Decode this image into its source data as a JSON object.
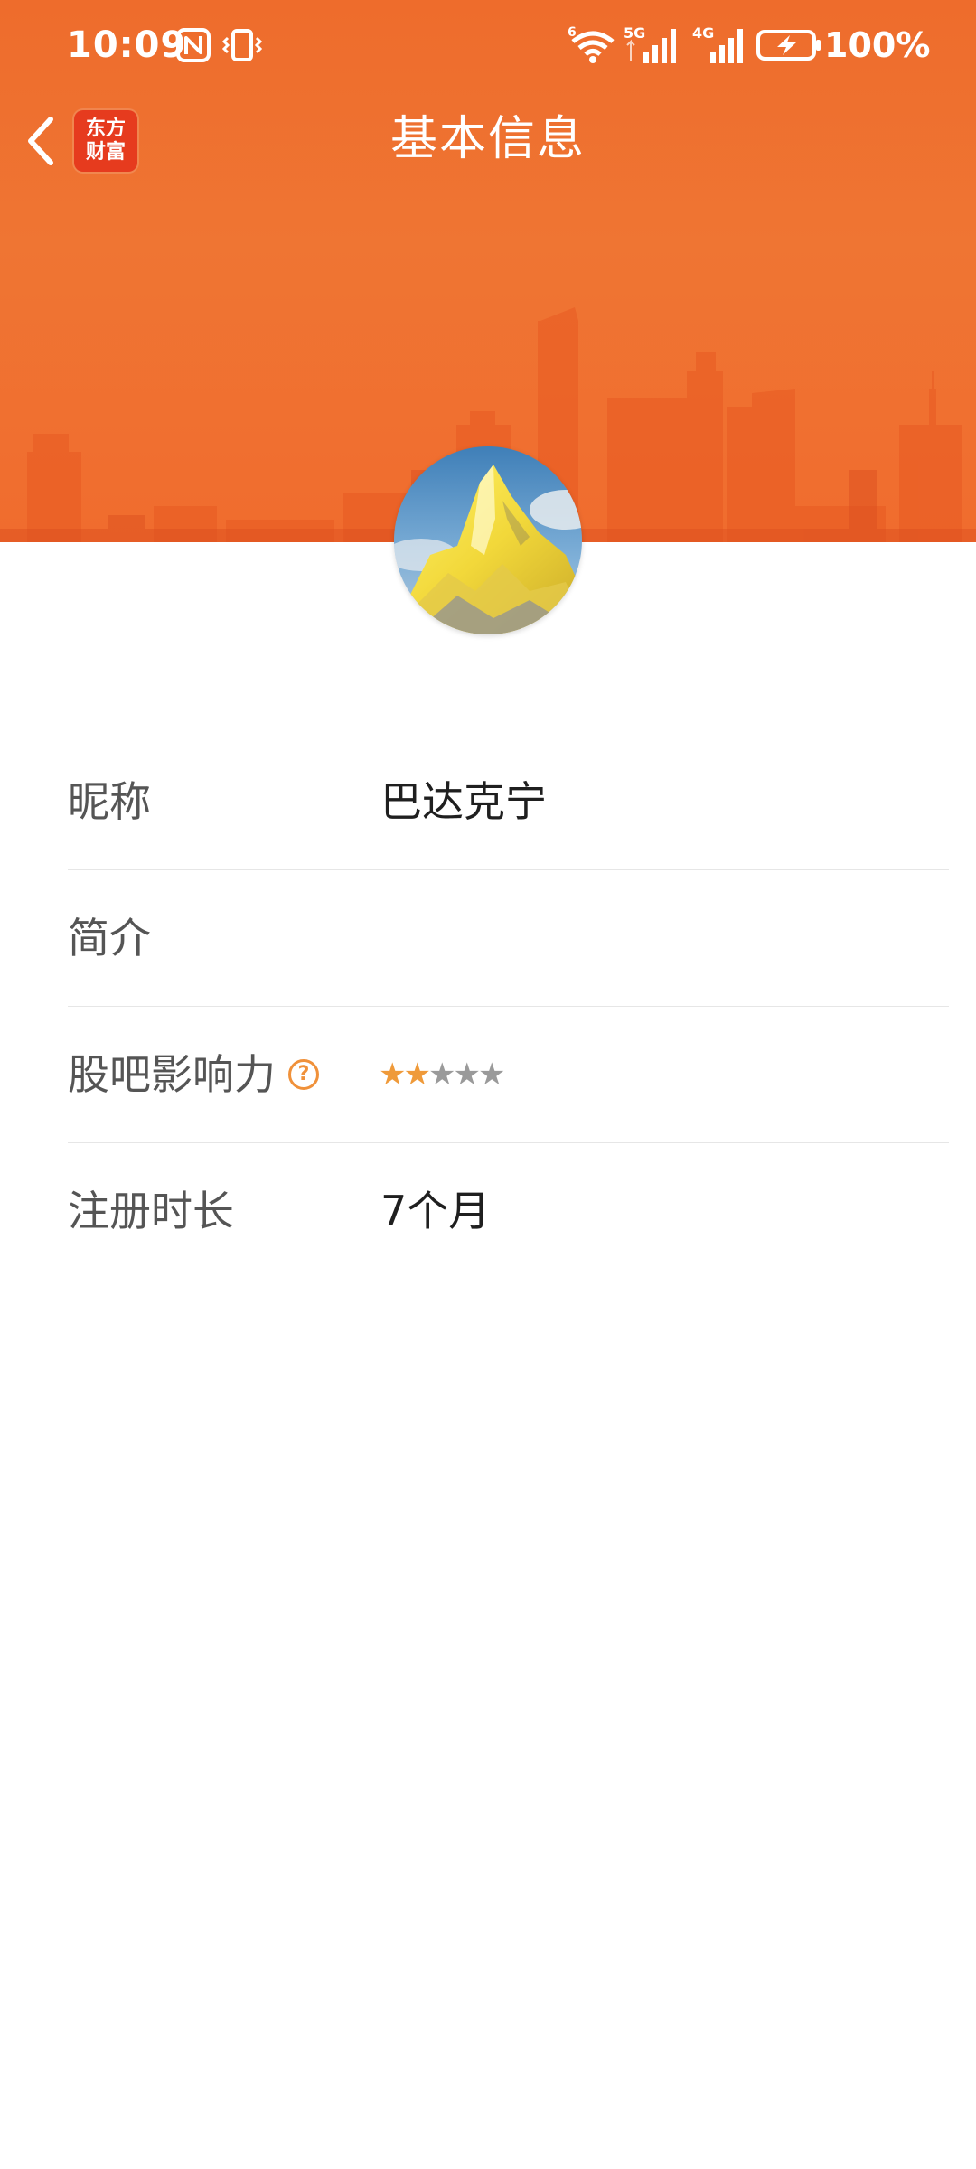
{
  "status_bar": {
    "time": "10:09",
    "battery_percent": "100%",
    "network_5g_label": "5G",
    "network_4g_label": "4G",
    "wifi_label": "6",
    "icons": [
      "nfc-icon",
      "vibrate-icon",
      "wifi-icon",
      "signal-5g-icon",
      "signal-4g-icon",
      "battery-charging-icon"
    ]
  },
  "header": {
    "title": "基本信息",
    "back_icon": "chevron-left-icon",
    "logo_line1": "东方",
    "logo_line2": "财富",
    "background_color": "#ef7030"
  },
  "profile": {
    "avatar_description": "mountain-avatar",
    "rows": [
      {
        "label": "昵称",
        "value": "巴达克宁"
      },
      {
        "label": "简介",
        "value": ""
      },
      {
        "label": "股吧影响力",
        "help_icon": "?",
        "rating": 2,
        "rating_max": 5
      },
      {
        "label": "注册时长",
        "value": "7个月"
      }
    ]
  },
  "colors": {
    "accent": "#ef7030",
    "star_filled": "#ef9a3a",
    "star_empty": "#9a9a9a",
    "help_icon": "#f0913a"
  }
}
